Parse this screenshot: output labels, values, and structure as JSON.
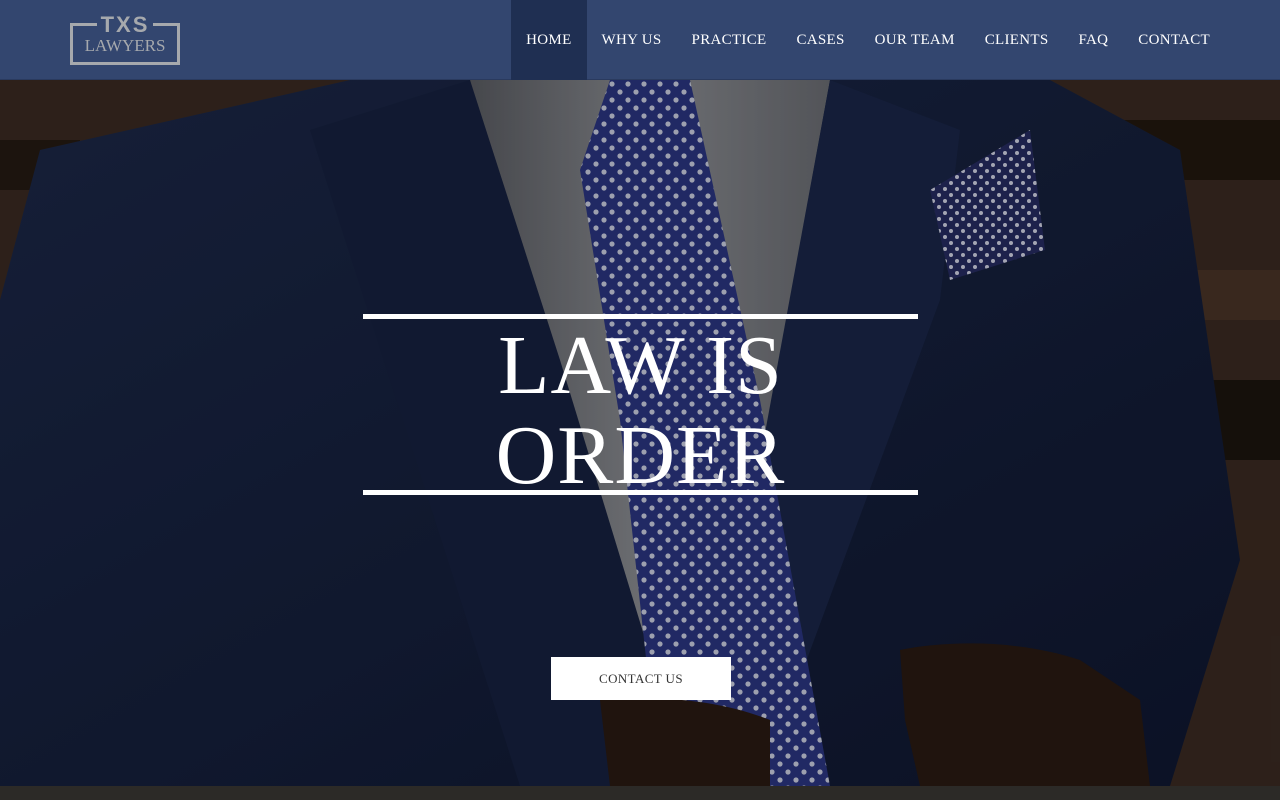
{
  "brand": {
    "logo_top": "TXS",
    "logo_bottom": "LAWYERS"
  },
  "nav": {
    "items": [
      {
        "label": "HOME",
        "active": true
      },
      {
        "label": "WHY US"
      },
      {
        "label": "PRACTICE"
      },
      {
        "label": "CASES"
      },
      {
        "label": "OUR TEAM"
      },
      {
        "label": "CLIENTS"
      },
      {
        "label": "FAQ"
      },
      {
        "label": "CONTACT"
      }
    ]
  },
  "hero": {
    "headline_line1": "LAW IS",
    "headline_line2": "ORDER",
    "cta_label": "CONTACT US"
  },
  "colors": {
    "header_bg": "#33466f",
    "nav_active_bg": "#1f2f52",
    "logo_gray": "#a6a9ad"
  }
}
